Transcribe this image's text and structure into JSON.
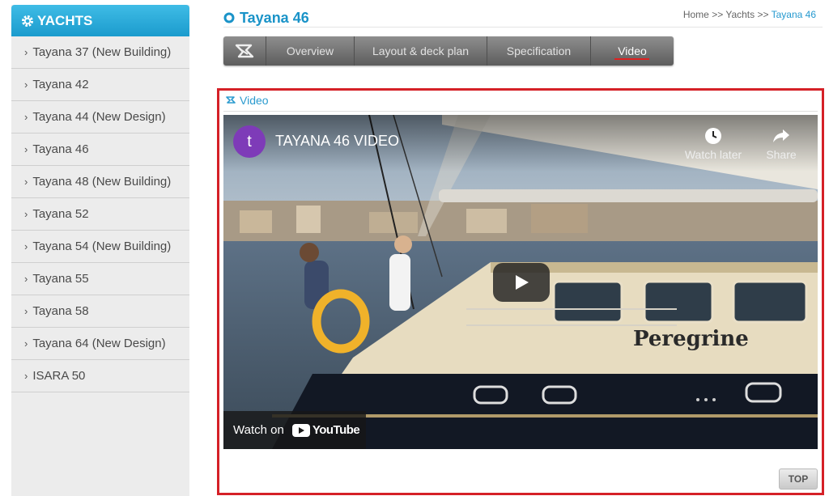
{
  "sidebar": {
    "header": "YACHTS",
    "items": [
      {
        "label": "Tayana 37 (New Building)"
      },
      {
        "label": "Tayana 42"
      },
      {
        "label": "Tayana 44 (New Design)"
      },
      {
        "label": "Tayana 46"
      },
      {
        "label": "Tayana 48 (New Building)"
      },
      {
        "label": "Tayana 52"
      },
      {
        "label": "Tayana 54 (New Building)"
      },
      {
        "label": "Tayana 55"
      },
      {
        "label": "Tayana 58"
      },
      {
        "label": "Tayana 64 (New Design)"
      },
      {
        "label": "ISARA 50"
      }
    ]
  },
  "page": {
    "title": "Tayana 46",
    "breadcrumb": {
      "home": "Home",
      "sep": ">>",
      "section": "Yachts",
      "current": "Tayana 46"
    }
  },
  "tabs": [
    {
      "label": "Overview"
    },
    {
      "label": "Layout & deck plan"
    },
    {
      "label": "Specification"
    },
    {
      "label": "Video",
      "active": true
    }
  ],
  "video_section": {
    "label": "Video",
    "player": {
      "channel_initial": "t",
      "title": "TAYANA 46 VIDEO",
      "watch_later": "Watch later",
      "share": "Share",
      "watch_on": "Watch on",
      "youtube": "YouTube",
      "boat_name": "Peregrine"
    }
  },
  "top_button": "TOP",
  "colors": {
    "accent": "#1b9bcd",
    "frame_border": "#d52027",
    "avatar": "#7e3bb8"
  },
  "icons": [
    "gear-icon",
    "chevron-right-icon",
    "circle-ring-icon",
    "brand-logo-icon",
    "play-icon",
    "clock-icon",
    "share-arrow-icon",
    "youtube-logo-icon"
  ]
}
